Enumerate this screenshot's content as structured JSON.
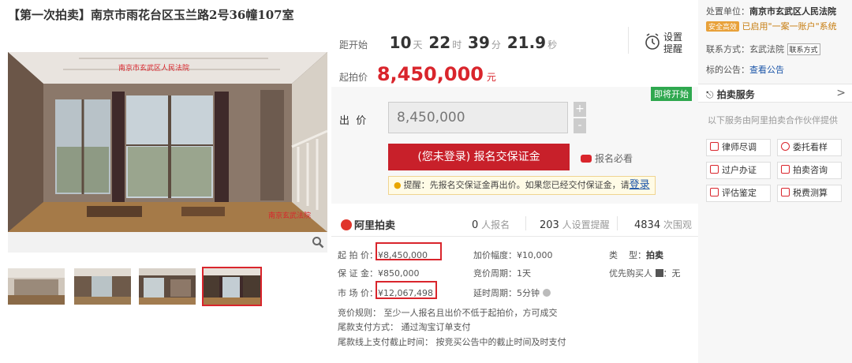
{
  "title": "【第一次拍卖】南京市雨花台区玉兰路2号36幢107室",
  "gallery": {
    "watermark_top": "南京市玄武区人民法院",
    "watermark_bottom": "南京玄武法院"
  },
  "countdown": {
    "label": "距开始",
    "days": "10",
    "days_unit": "天",
    "hours": "22",
    "hours_unit": "时",
    "minutes": "39",
    "minutes_unit": "分",
    "seconds": "21.9",
    "seconds_unit": "秒"
  },
  "remind": {
    "label_1": "设置",
    "label_2": "提醒"
  },
  "start": {
    "label": "起拍价",
    "price": "8,450,000",
    "unit": "元"
  },
  "bid": {
    "soon_badge": "即将开始",
    "label": "出  价",
    "value": "8,450,000",
    "plus": "+",
    "minus": "-",
    "signup_button": "(您未登录) 报名交保证金",
    "must_read": "报名必看",
    "tip": "提醒：先报名交保证金再出价。如果您已经交付保证金，请",
    "tip_login": "登录"
  },
  "stats": {
    "logo": "阿里拍卖",
    "signups": "0",
    "signups_label": "人报名",
    "reminders": "203",
    "reminders_label": "人设置提醒",
    "views": "4834",
    "views_label": "次围观"
  },
  "info": {
    "start_price_label": "起 拍 价",
    "start_price": "¥8,450,000",
    "deposit_label": "保 证 金",
    "deposit": "¥850,000",
    "market_label": "市 场 价",
    "market": "¥12,067,498",
    "increment_label": "加价幅度",
    "increment": "¥10,000",
    "period_label": "竞价周期",
    "period": "1天",
    "delay_label": "延时周期",
    "delay": "5分钟",
    "type_label": "类    型",
    "type": "拍卖",
    "priority_label": "优先购买人",
    "priority": "无",
    "rule": "竞价规则：  至少一人报名且出价不低于起拍价，方可成交",
    "payment": "尾款支付方式：  通过淘宝订单支付",
    "deadline": "尾款线上支付截止时间：  按竞买公告中的截止时间及时支付"
  },
  "sidebar": {
    "unit_label": "处置单位：",
    "unit": "南京市玄武区人民法院",
    "safe_badge": "安全高效",
    "account_text": "已启用\"一案一账户\"系统",
    "contact_label": "联系方式：",
    "contact": "玄武法院",
    "contact_tag": "联系方式",
    "notice_label": "标的公告：",
    "notice_link": "查看公告",
    "service_title": "拍卖服务",
    "service_desc": "以下服务由阿里拍卖合作伙伴提供",
    "services": [
      "律师尽调",
      "委托看样",
      "过户办证",
      "拍卖咨询",
      "评估鉴定",
      "税费测算"
    ]
  }
}
